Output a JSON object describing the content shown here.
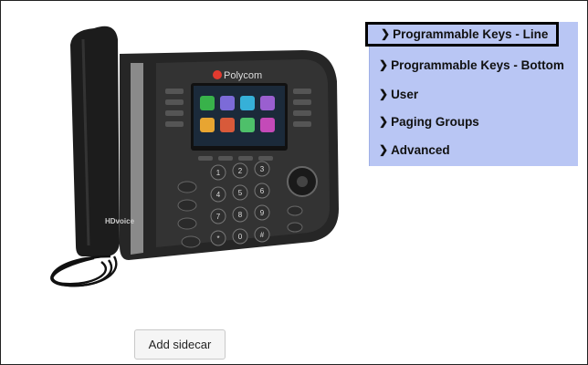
{
  "menu": {
    "items": [
      {
        "label": "Programmable Keys - Line",
        "highlighted": true
      },
      {
        "label": "Programmable Keys - Bottom",
        "highlighted": false
      },
      {
        "label": "User",
        "highlighted": false
      },
      {
        "label": "Paging Groups",
        "highlighted": false
      },
      {
        "label": "Advanced",
        "highlighted": false
      }
    ]
  },
  "phone": {
    "brand": "Polycom",
    "hd_badge": "HDvoice",
    "keypad": [
      "1",
      "2",
      "3",
      "4",
      "5",
      "6",
      "7",
      "8",
      "9",
      "*",
      "0",
      "#"
    ]
  },
  "actions": {
    "add_sidecar_label": "Add sidecar"
  },
  "colors": {
    "menu_bg": "#b9c6f4",
    "highlight_border": "#000000"
  }
}
